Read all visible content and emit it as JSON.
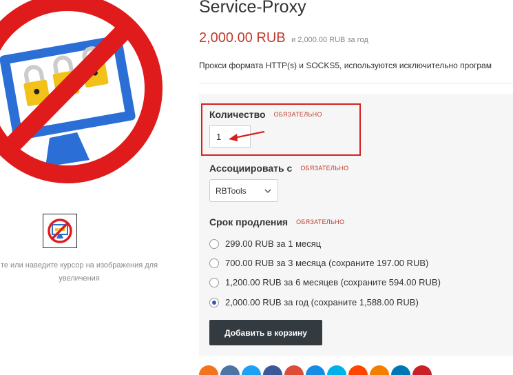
{
  "product": {
    "title": "Service-Proxy",
    "price_main": "2,000.00 RUB",
    "price_sub": "и 2,000.00 RUB за год",
    "description": "Прокси формата HTTP(s) и SOCKS5, используются исключительно програм",
    "zoom_hint": "те или наведите курсор на изображения для увеличения"
  },
  "form": {
    "required_label": "ОБЯЗАТЕЛЬНО",
    "quantity": {
      "label": "Количество",
      "value": "1"
    },
    "associate": {
      "label": "Ассоциировать с",
      "selected": "RBTools"
    },
    "term": {
      "label": "Срок продления",
      "options": [
        {
          "label": "299.00 RUB за 1 месяц",
          "checked": false
        },
        {
          "label": "700.00 RUB за 3 месяца (сохраните 197.00 RUB)",
          "checked": false
        },
        {
          "label": "1,200.00 RUB за 6 месяцев (сохраните 594.00 RUB)",
          "checked": false
        },
        {
          "label": "2,000.00 RUB за год (сохраните 1,588.00 RUB)",
          "checked": true
        }
      ]
    },
    "add_to_cart": "Добавить в корзину"
  },
  "colors": {
    "price": "#c0392b",
    "highlight": "#d42020",
    "button": "#333a40",
    "radio_selected": "#2a5db0"
  },
  "share_icons": [
    {
      "name": "odnoklassniki-icon",
      "color": "#f4731c"
    },
    {
      "name": "vk-icon",
      "color": "#4c75a3"
    },
    {
      "name": "twitter-icon",
      "color": "#1da1f2"
    },
    {
      "name": "facebook-icon",
      "color": "#3b5998"
    },
    {
      "name": "google-plus-icon",
      "color": "#dd4b39"
    },
    {
      "name": "mail-ru-icon",
      "color": "#168de2"
    },
    {
      "name": "livejournal-icon",
      "color": "#00b0ea"
    },
    {
      "name": "reddit-icon",
      "color": "#ff4500"
    },
    {
      "name": "blogger-icon",
      "color": "#f57d00"
    },
    {
      "name": "linkedin-icon",
      "color": "#0077b5"
    },
    {
      "name": "pinterest-icon",
      "color": "#cb2027"
    }
  ]
}
